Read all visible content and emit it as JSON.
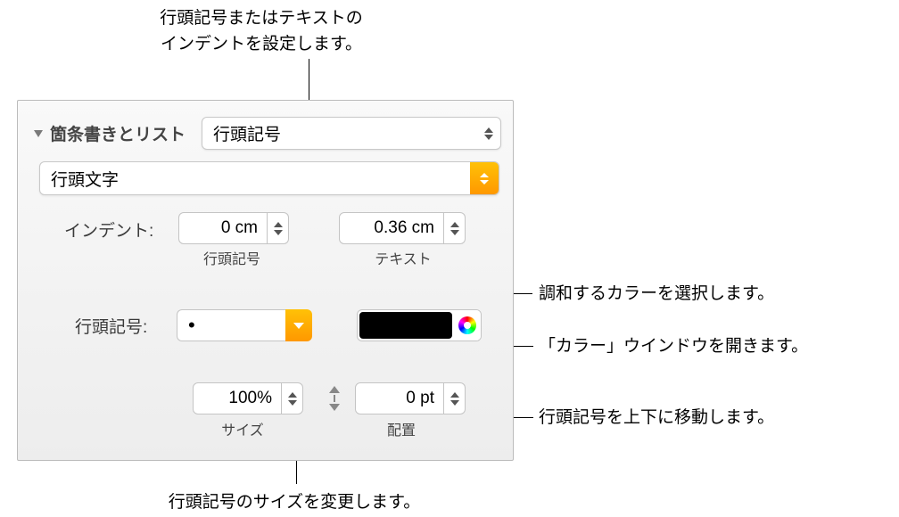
{
  "callouts": {
    "top": "行頭記号またはテキストの\nインデントを設定します。",
    "color_match": "調和するカラーを選択します。",
    "color_window": "「カラー」ウインドウを開きます。",
    "move_vertical": "行頭記号を上下に移動します。",
    "resize": "行頭記号のサイズを変更します。"
  },
  "panel": {
    "section_title": "箇条書きとリスト",
    "list_type": "行頭記号",
    "bullet_char_select": "行頭文字",
    "indent_label": "インデント:",
    "indent_bullet_value": "0 cm",
    "indent_bullet_sublabel": "行頭記号",
    "indent_text_value": "0.36 cm",
    "indent_text_sublabel": "テキスト",
    "bullet_row_label": "行頭記号:",
    "bullet_glyph": "•",
    "bullet_color": "#000000",
    "size_value": "100%",
    "size_sublabel": "サイズ",
    "align_value": "0 pt",
    "align_sublabel": "配置"
  }
}
